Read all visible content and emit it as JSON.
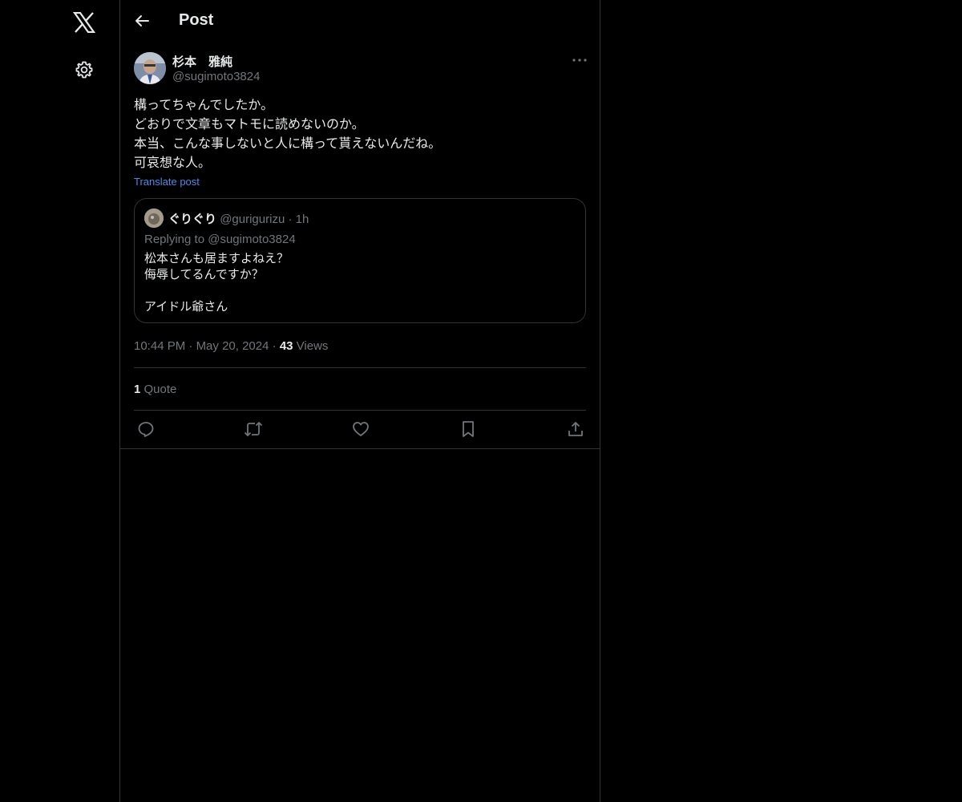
{
  "nav": {
    "logo_icon": "x-logo-icon",
    "settings_icon": "gear-icon"
  },
  "header": {
    "title": "Post",
    "back_icon": "arrow-left-icon"
  },
  "post": {
    "author_name": "杉本　雅純",
    "author_handle": "@sugimoto3824",
    "text_lines": [
      "構ってちゃんでしたか。",
      "どおりで文章もマトモに読めないのか。",
      "本当、こんな事しないと人に構って貰えないんだね。",
      "可哀想な人。"
    ],
    "translate_label": "Translate post",
    "time": "10:44 PM",
    "date": "May 20, 2024",
    "views_count": "43",
    "views_label": "Views",
    "quote_count": "1",
    "quote_label": "Quote"
  },
  "quoted": {
    "name": "ぐりぐり",
    "handle": "@gurigurizu",
    "time": "1h",
    "replying_to": "Replying to @sugimoto3824",
    "text_lines": [
      "松本さんも居ますよねえ？",
      "侮辱してるんですか？",
      "",
      "アイドル爺さん"
    ]
  },
  "actions": [
    "reply-icon",
    "repost-icon",
    "like-icon",
    "bookmark-icon",
    "share-icon"
  ],
  "colors": {
    "background": "#000000",
    "text": "#e7e9ea",
    "secondary": "#71767b",
    "link": "#4c8ce6",
    "border": "#2f3336"
  }
}
